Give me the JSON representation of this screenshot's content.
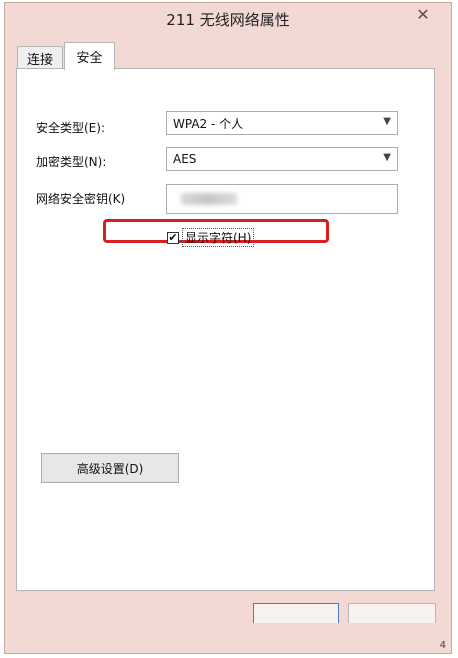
{
  "window": {
    "title": "211 无线网络属性",
    "close_glyph": "✕",
    "corner_digit": "4"
  },
  "tabs": [
    {
      "label": "连接",
      "active": false
    },
    {
      "label": "安全",
      "active": true
    }
  ],
  "security": {
    "type_label": "安全类型(E):",
    "type_value": "WPA2 - 个人",
    "encryption_label": "加密类型(N):",
    "encryption_value": "AES",
    "key_label": "网络安全密钥(K)",
    "show_chars_label": "显示字符(H)",
    "show_chars_checked": "✔"
  },
  "buttons": {
    "advanced": "高级设置(D)"
  },
  "colors": {
    "accent": "#d42020",
    "window_bg": "#f3d9d3"
  }
}
